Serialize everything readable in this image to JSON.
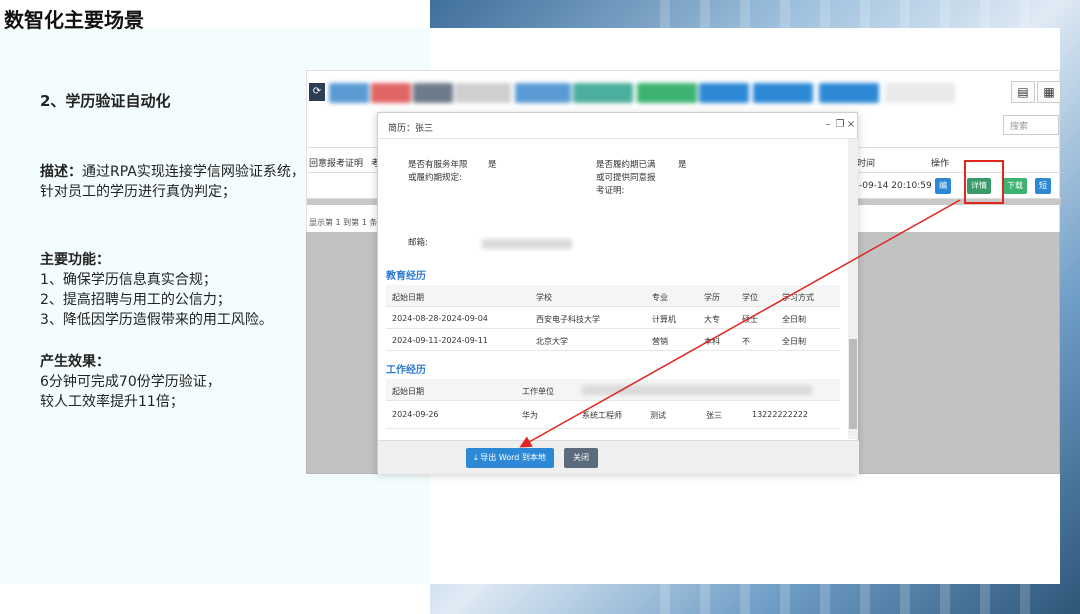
{
  "slide_title": "数智化主要场景",
  "subtitle": "2、学历验证自动化",
  "description": {
    "head": "描述：",
    "text": "通过RPA实现连接学信网验证系统，针对员工的学历进行真伪判定；"
  },
  "features": {
    "head": "主要功能：",
    "items": [
      "1、确保学历信息真实合规；",
      "2、提高招聘与用工的公信力；",
      "3、降低因学历造假带来的用工风险。"
    ]
  },
  "effect": {
    "head": "产生效果：",
    "lines": [
      "6分钟可完成70份学历验证，",
      "较人工效率提升11倍；"
    ]
  },
  "app": {
    "search_placeholder": "搜索",
    "table_headers": [
      "回意报考证明",
      "考",
      "时间",
      "操作"
    ],
    "row_time": "-09-14 20:10:59",
    "row_actions": [
      "编",
      "详情",
      "下载",
      "短"
    ],
    "footer": "显示第 1 到第 1 条记",
    "accent": "#e0261f"
  },
  "dialog": {
    "title": "简历：张三",
    "fields": [
      {
        "label": "是否有服务年限或履约期规定:",
        "value": "是"
      },
      {
        "label": "是否履约期已满或可提供同意报考证明:",
        "value": "是"
      },
      {
        "label": "邮箱:",
        "value": ""
      }
    ],
    "education": {
      "title": "教育经历",
      "headers": [
        "起始日期",
        "学校",
        "专业",
        "学历",
        "学位",
        "学习方式"
      ],
      "rows": [
        [
          "2024-08-28-2024-09-04",
          "西安电子科技大学",
          "计算机",
          "大专",
          "硕士",
          "全日制"
        ],
        [
          "2024-09-11-2024-09-11",
          "北京大学",
          "营销",
          "本科",
          "不",
          "全日制"
        ]
      ]
    },
    "work": {
      "title": "工作经历",
      "headers": [
        "起始日期",
        "工作单位"
      ],
      "rows": [
        [
          "2024-09-26",
          "华为",
          "系统工程师",
          "测试",
          "张三",
          "13222222222"
        ]
      ]
    },
    "export_button": "导出 Word 到本地",
    "close_button": "关闭"
  }
}
